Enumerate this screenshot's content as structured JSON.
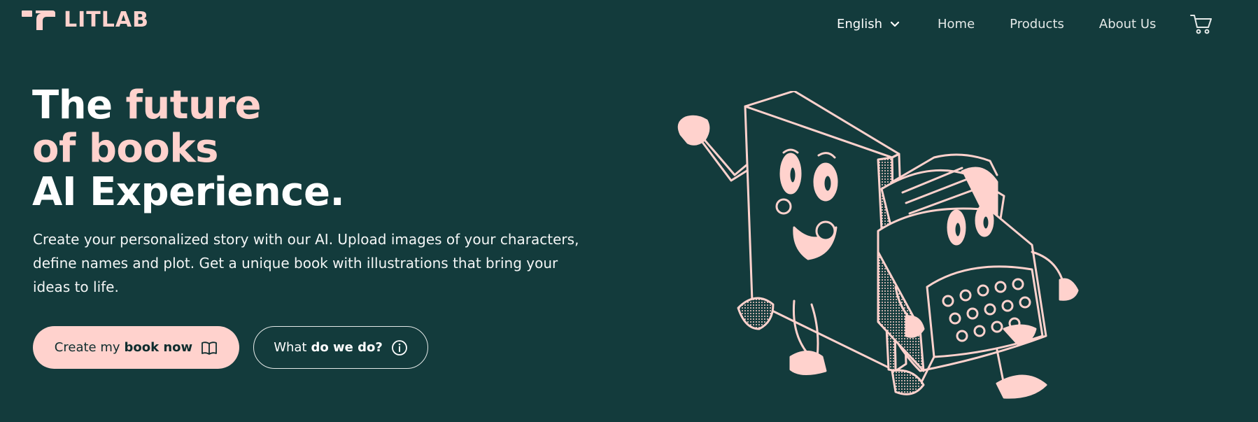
{
  "brand": {
    "name": "LITLAB",
    "accent_color": "#ffd2cd",
    "background_color": "#133b3c"
  },
  "nav": {
    "language": "English",
    "language_icon": "chevron-down-icon",
    "items": [
      "Home",
      "Products",
      "About Us"
    ],
    "cart_icon": "cart-icon"
  },
  "hero": {
    "title_word_the": "The",
    "title_word_future": "future",
    "title_line2": "of books",
    "title_line3": "AI Experience.",
    "description_line1": "Create your personalized story with our AI. Upload images of your characters,",
    "description_line2": "define names and plot. Get a unique book with illustrations that bring your",
    "description_line3": "ideas to life.",
    "primary_button": {
      "text": "Create my",
      "bold": "book now",
      "icon": "book-icon"
    },
    "secondary_button": {
      "text": "What",
      "bold": "do we do?",
      "icon": "info-icon"
    },
    "illustration": "book-and-typewriter-characters-illustration"
  }
}
